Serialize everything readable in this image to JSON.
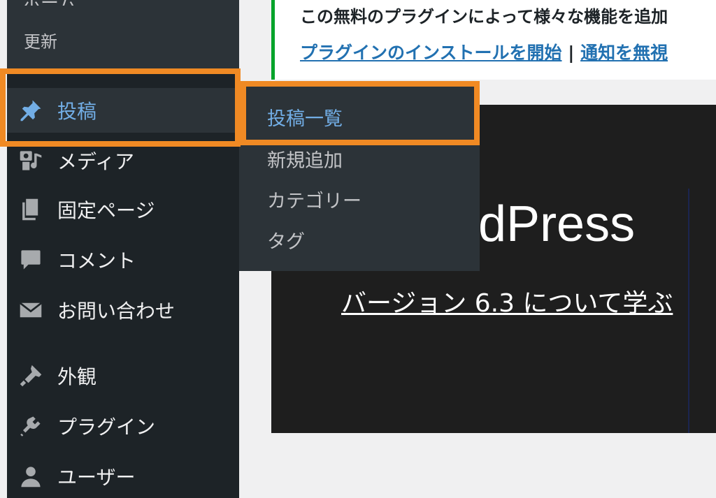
{
  "sidebar": {
    "partial_top_label": "ホーム",
    "update_label": "更新",
    "items": [
      {
        "label": "投稿",
        "icon": "pushpin-icon",
        "active": true
      },
      {
        "label": "メディア",
        "icon": "media-icon"
      },
      {
        "label": "固定ページ",
        "icon": "pages-icon"
      },
      {
        "label": "コメント",
        "icon": "comment-icon"
      },
      {
        "label": "お問い合わせ",
        "icon": "email-icon"
      },
      {
        "label": "外観",
        "icon": "paintbrush-icon"
      },
      {
        "label": "プラグイン",
        "icon": "plugin-icon"
      },
      {
        "label": "ユーザー",
        "icon": "user-icon"
      }
    ]
  },
  "flyout": {
    "items": [
      {
        "label": "投稿一覧",
        "current": true
      },
      {
        "label": "新規追加"
      },
      {
        "label": "カテゴリー"
      },
      {
        "label": "タグ"
      }
    ]
  },
  "notice": {
    "text": "この無料のプラグインによって様々な機能を追加",
    "install_link": "プラグインのインストールを開始",
    "separator": " | ",
    "dismiss_link": "通知を無視"
  },
  "welcome": {
    "title": "dPress",
    "version_link": "バージョン 6.3 について学ぶ"
  },
  "colors": {
    "sidebar_bg": "#1d2327",
    "submenu_bg": "#2c3338",
    "accent_blue": "#72aee6",
    "highlight_orange": "#f08a24",
    "notice_border": "#00a32a",
    "link_blue": "#2271b1"
  }
}
